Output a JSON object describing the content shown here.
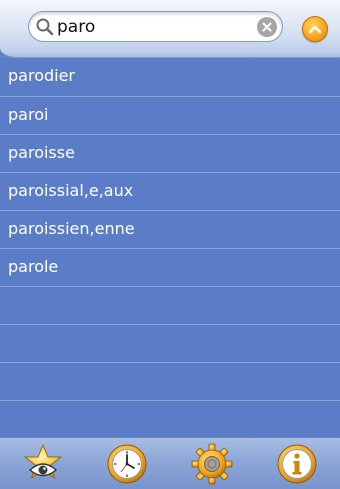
{
  "search": {
    "value": "paro",
    "icons": {
      "search": "magnifier-icon",
      "clear": "clear-x-icon"
    }
  },
  "header": {
    "collapse_icon": "chevron-up-icon",
    "accent_color": "#f6a21a"
  },
  "results": [
    "parodier",
    "paroi",
    "paroisse",
    "paroissial,e,aux",
    "paroissien,enne",
    "parole",
    "",
    "",
    "",
    ""
  ],
  "toolbar": {
    "items": [
      {
        "icon": "eye-star-icon"
      },
      {
        "icon": "clock-icon"
      },
      {
        "icon": "gear-icon"
      },
      {
        "icon": "info-icon"
      }
    ]
  },
  "colors": {
    "list_background": "#5b7dc7",
    "separator": "#8ea6db",
    "text": "#ffffff"
  }
}
